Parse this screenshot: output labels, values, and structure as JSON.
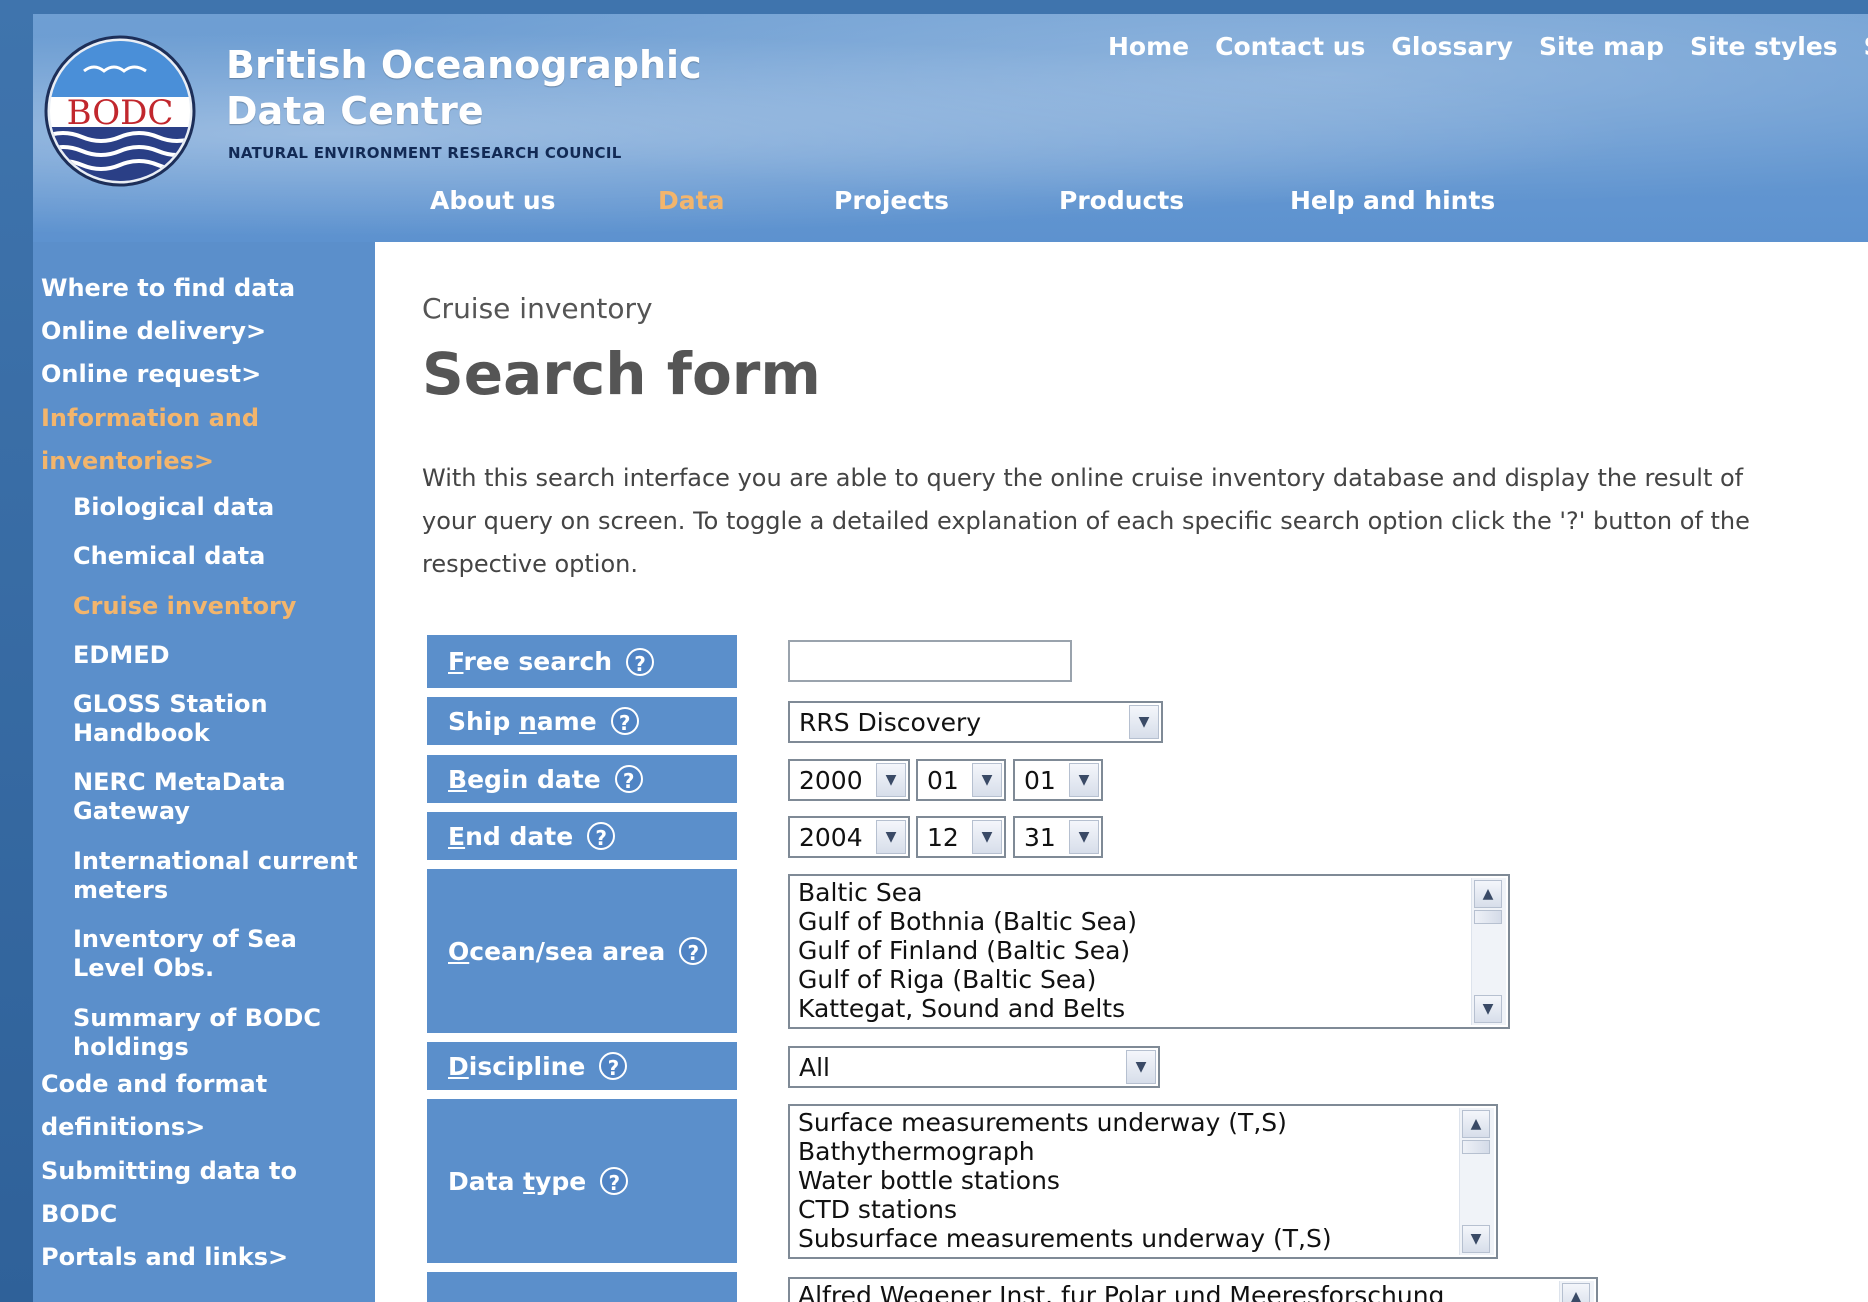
{
  "header": {
    "logo_text": "BODC",
    "org_title_line1": "British Oceanographic",
    "org_title_line2": "Data Centre",
    "org_subtitle": "NATURAL ENVIRONMENT RESEARCH COUNCIL",
    "top_links": [
      "Home",
      "Contact us",
      "Glossary",
      "Site map",
      "Site styles",
      "Se"
    ],
    "main_nav": [
      {
        "label": "About us",
        "active": false
      },
      {
        "label": "Data",
        "active": true
      },
      {
        "label": "Projects",
        "active": false
      },
      {
        "label": "Products",
        "active": false
      },
      {
        "label": "Help and hints",
        "active": false
      }
    ]
  },
  "sidebar": {
    "items": [
      {
        "label": "Where to find data"
      },
      {
        "label": "Online delivery>"
      },
      {
        "label": "Online request>"
      },
      {
        "label": "Information and"
      },
      {
        "label": "inventories>"
      },
      {
        "label": "Biological data"
      },
      {
        "label": "Chemical data"
      },
      {
        "label": "Cruise inventory"
      },
      {
        "label": "EDMED"
      },
      {
        "label": "GLOSS Station"
      },
      {
        "label": "Handbook"
      },
      {
        "label": "NERC MetaData"
      },
      {
        "label": "Gateway"
      },
      {
        "label": "International current"
      },
      {
        "label": "meters"
      },
      {
        "label": "Inventory of Sea"
      },
      {
        "label": "Level Obs."
      },
      {
        "label": "Summary of BODC"
      },
      {
        "label": "holdings"
      },
      {
        "label": "Code and format"
      },
      {
        "label": "definitions>"
      },
      {
        "label": "Submitting data to"
      },
      {
        "label": "BODC"
      },
      {
        "label": "Portals and links>"
      }
    ]
  },
  "content": {
    "breadcrumb": "Cruise inventory",
    "title": "Search form",
    "intro_line1": "With this search interface you are able to query the online cruise inventory database and display the result of",
    "intro_line2": "your query on screen. To toggle a detailed explanation of each specific search option click the '?' button of the",
    "intro_line3": "respective option."
  },
  "form": {
    "help_glyph": "?",
    "free_search": {
      "label_first": "F",
      "label_rest": "ree search",
      "value": ""
    },
    "ship_name": {
      "label_pre": "Ship ",
      "label_u": "n",
      "label_post": "ame",
      "value": "RRS Discovery"
    },
    "begin_date": {
      "label_first": "B",
      "label_rest": "egin date",
      "year": "2000",
      "month": "01",
      "day": "01"
    },
    "end_date": {
      "label_first": "E",
      "label_rest": "nd date",
      "year": "2004",
      "month": "12",
      "day": "31"
    },
    "ocean_area": {
      "label_first": "O",
      "label_rest": "cean/sea area",
      "options": [
        "Baltic Sea",
        "Gulf of Bothnia (Baltic Sea)",
        "Gulf of Finland (Baltic Sea)",
        "Gulf of Riga (Baltic Sea)",
        "Kattegat, Sound and Belts"
      ]
    },
    "discipline": {
      "label_first": "D",
      "label_rest": "iscipline",
      "value": "All"
    },
    "data_type": {
      "label_pre": "Data ",
      "label_u": "t",
      "label_post": "ype",
      "options": [
        "Surface measurements underway (T,S)",
        "Bathythermograph",
        "Water bottle stations",
        "CTD stations",
        "Subsurface measurements underway (T,S)"
      ]
    },
    "institution": {
      "options": [
        "Alfred Wegener Inst. fur Polar und Meeresforschung"
      ]
    }
  }
}
